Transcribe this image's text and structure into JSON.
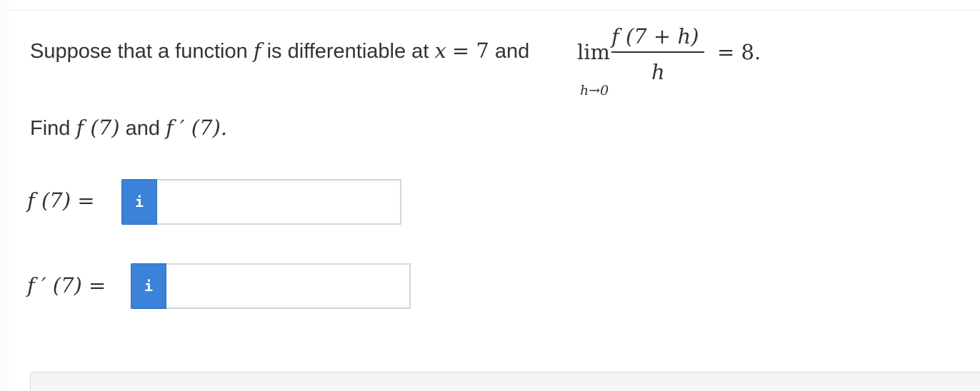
{
  "question": {
    "intro": "Suppose that a function",
    "f": "f",
    "differentiable_text": "is differentiable at",
    "x": "x",
    "eq_seven": "= 7",
    "and": "and",
    "lim": "lim",
    "lim_sub": "h→0",
    "frac_num": "f (7 + h)",
    "frac_den": "h",
    "eq_end": "= 8.",
    "find_word": "Find",
    "find_f7": "f (7)",
    "find_and": "and",
    "find_fp7": "f ′ (7)."
  },
  "answers": [
    {
      "label": "f (7)  =",
      "info": "i",
      "value": "",
      "placeholder": ""
    },
    {
      "label": "f ′ (7)  =",
      "info": "i",
      "value": "",
      "placeholder": ""
    }
  ],
  "colors": {
    "info_button": "#3b82d8",
    "text": "#333333"
  }
}
